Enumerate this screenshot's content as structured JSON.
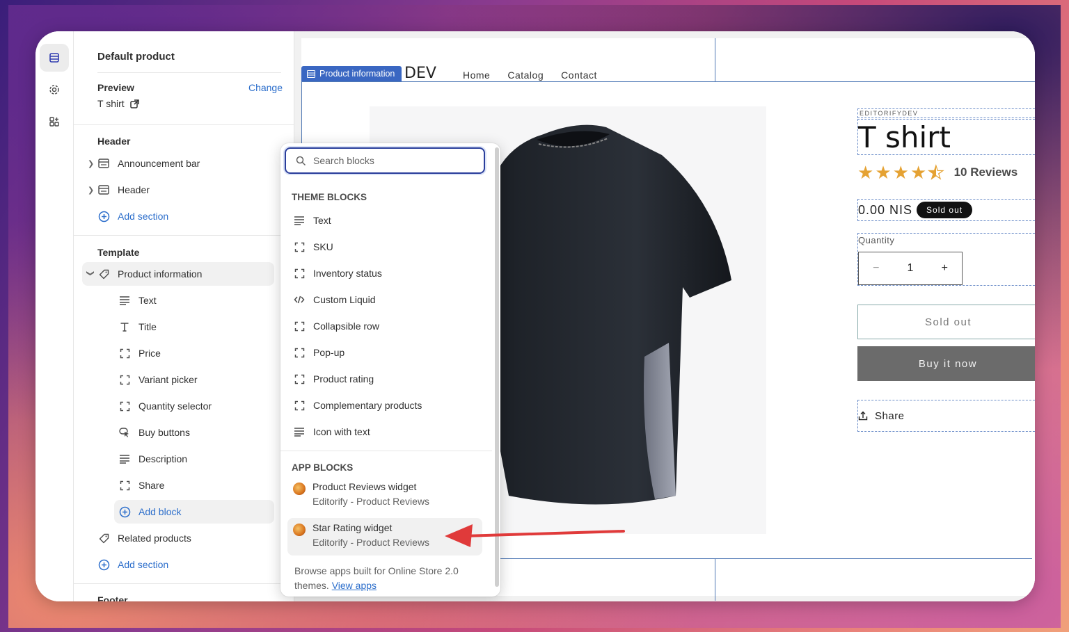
{
  "sidebar": {
    "title": "Default product",
    "preview_label": "Preview",
    "change_label": "Change",
    "preview_value": "T shirt",
    "header_heading": "Header",
    "header_items": [
      {
        "label": "Announcement bar",
        "icon": "section-icon"
      },
      {
        "label": "Header",
        "icon": "section-icon"
      }
    ],
    "add_section_label": "Add section",
    "template_heading": "Template",
    "product_information_label": "Product information",
    "blocks": [
      {
        "label": "Text",
        "icon": "text-lines-icon"
      },
      {
        "label": "Title",
        "icon": "title-t-icon"
      },
      {
        "label": "Price",
        "icon": "block-bracket-icon"
      },
      {
        "label": "Variant picker",
        "icon": "block-bracket-icon"
      },
      {
        "label": "Quantity selector",
        "icon": "block-bracket-icon"
      },
      {
        "label": "Buy buttons",
        "icon": "cursor-click-icon"
      },
      {
        "label": "Description",
        "icon": "text-lines-icon"
      },
      {
        "label": "Share",
        "icon": "block-bracket-icon"
      }
    ],
    "add_block_label": "Add block",
    "related_products_label": "Related products",
    "add_section_label_2": "Add section",
    "footer_heading": "Footer"
  },
  "popover": {
    "search_placeholder": "Search blocks",
    "theme_heading": "THEME BLOCKS",
    "theme_blocks": [
      {
        "label": "Text",
        "icon": "text-lines-icon"
      },
      {
        "label": "SKU",
        "icon": "block-bracket-icon"
      },
      {
        "label": "Inventory status",
        "icon": "block-bracket-icon"
      },
      {
        "label": "Custom Liquid",
        "icon": "code-icon"
      },
      {
        "label": "Collapsible row",
        "icon": "block-bracket-icon"
      },
      {
        "label": "Pop-up",
        "icon": "block-bracket-icon"
      },
      {
        "label": "Product rating",
        "icon": "block-bracket-icon"
      },
      {
        "label": "Complementary products",
        "icon": "block-bracket-icon"
      },
      {
        "label": "Icon with text",
        "icon": "text-lines-icon"
      }
    ],
    "app_heading": "APP BLOCKS",
    "app_blocks": [
      {
        "name": "Product Reviews widget",
        "vendor": "Editorify - Product Reviews"
      },
      {
        "name": "Star Rating widget",
        "vendor": "Editorify - Product Reviews"
      }
    ],
    "browse_text": "Browse apps built for Online Store 2.0 themes.",
    "view_apps_label": "View apps"
  },
  "store": {
    "section_badge": "Product information",
    "brand": "DEV",
    "nav": [
      "Home",
      "Catalog",
      "Contact"
    ],
    "vendor": "EDITORIFYDEV",
    "product_title": "T shirt",
    "rating": 4.5,
    "reviews_label": "10 Reviews",
    "price": "0.00 NIS",
    "sold_out_badge": "Sold out",
    "quantity_label": "Quantity",
    "quantity_value": "1",
    "qty_minus": "−",
    "qty_plus": "+",
    "sold_out_button": "Sold out",
    "buy_now_button": "Buy it now",
    "share_label": "Share"
  },
  "colors": {
    "accent_blue": "#2c6ecb",
    "selection_outline": "#4f78b5",
    "star": "#e5a233",
    "arrow": "#e03a3a"
  }
}
